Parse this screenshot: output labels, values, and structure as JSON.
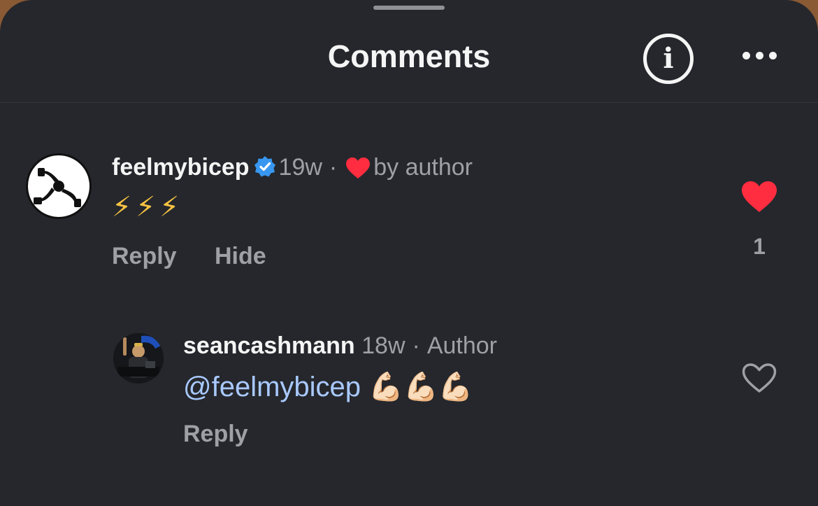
{
  "header": {
    "title": "Comments",
    "info_icon": "info-circle-icon",
    "more_icon": "more-horizontal-icon"
  },
  "comments": [
    {
      "username": "feelmybicep",
      "verified": true,
      "time": "19w",
      "separator": "·",
      "badge": "by author",
      "text": "⚡⚡⚡",
      "reply_label": "Reply",
      "hide_label": "Hide",
      "liked": true,
      "like_count": "1"
    },
    {
      "username": "seancashmann",
      "time": "18w",
      "separator": "·",
      "badge": "Author",
      "mention": "@feelmybicep",
      "text": "💪🏻💪🏻💪🏻",
      "reply_label": "Reply",
      "liked": false
    }
  ],
  "colors": {
    "background": "#25272c",
    "text": "#f5f5f5",
    "secondary": "#9ea0a6",
    "like_red": "#ff2d3f",
    "verified_blue": "#3897f0",
    "mention_blue": "#a9c9ff"
  }
}
